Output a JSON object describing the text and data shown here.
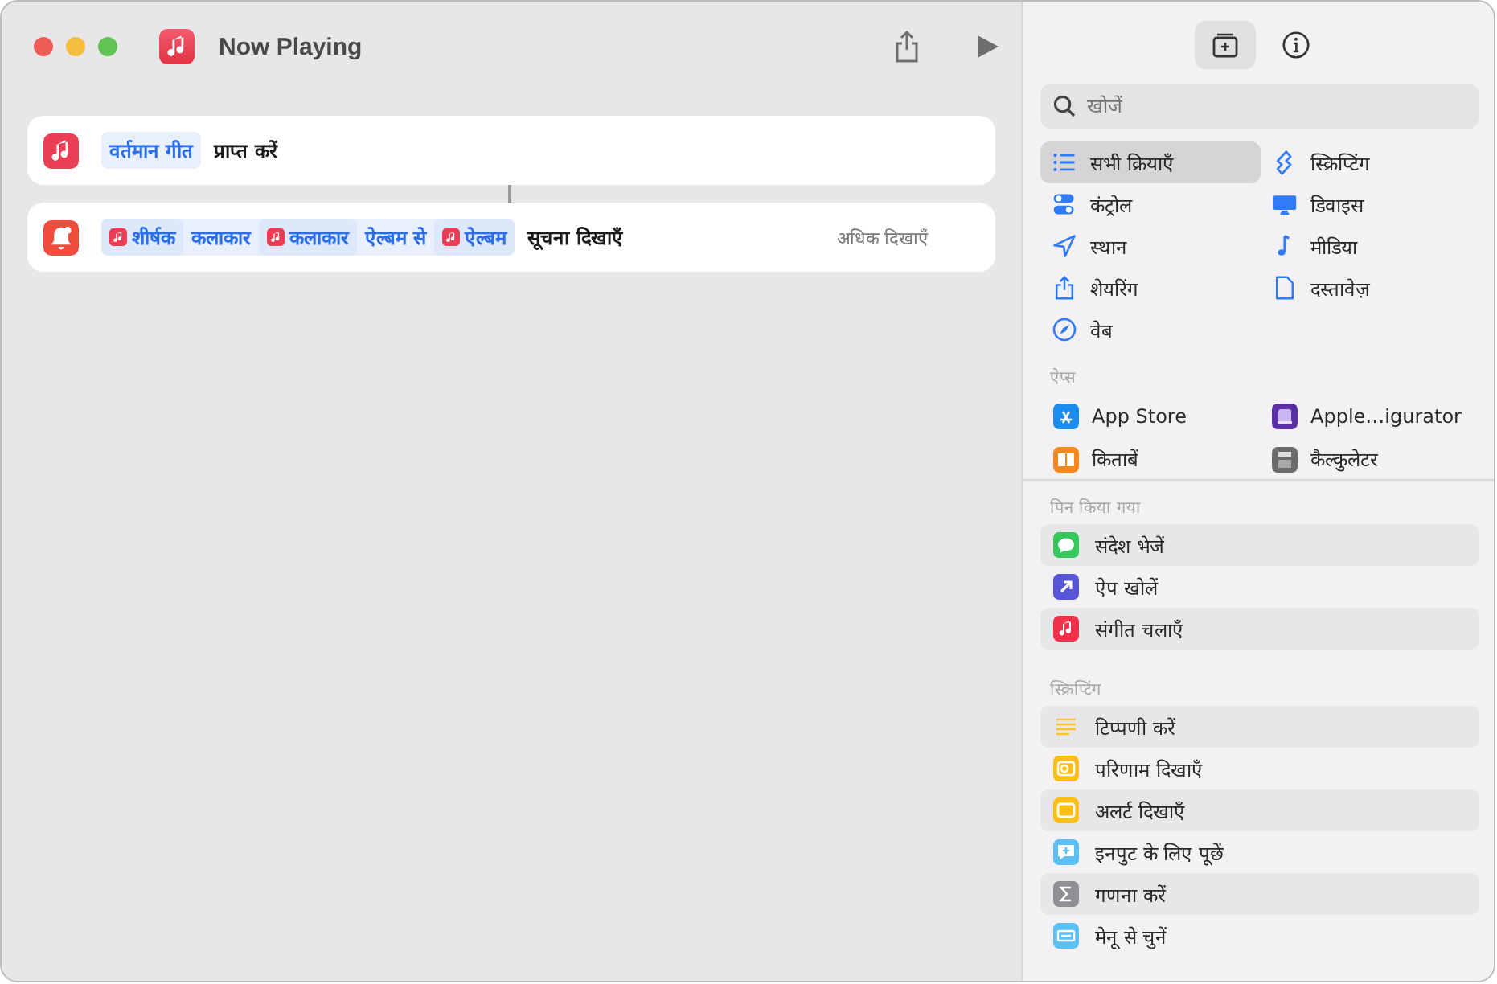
{
  "window": {
    "title": "Now Playing"
  },
  "actions": [
    {
      "kind": "get",
      "tokens": [
        {
          "text": "वर्तमान गीत",
          "icon": false
        }
      ],
      "label": "प्राप्त करें"
    },
    {
      "kind": "notify",
      "tokens": [
        {
          "text": "शीर्षक",
          "icon": true
        },
        {
          "text": "कलाकार",
          "icon": false
        },
        {
          "text": "कलाकार",
          "icon": true
        },
        {
          "text": "ऐल्बम से",
          "icon": false
        },
        {
          "text": "ऐल्बम",
          "icon": true
        }
      ],
      "label": "सूचना दिखाएँ",
      "more": "अधिक दिखाएँ"
    }
  ],
  "sidebar": {
    "tabs": [
      {
        "kind": "library",
        "selected": true
      },
      {
        "kind": "info",
        "selected": false
      }
    ],
    "search": {
      "placeholder": "खोजें"
    },
    "categories": [
      {
        "kind": "list",
        "label": "सभी क्रियाएँ",
        "selected": true
      },
      {
        "kind": "scripting",
        "label": "स्क्रिप्टिंग",
        "selected": false
      },
      {
        "kind": "toggle",
        "label": "कंट्रोल",
        "selected": false
      },
      {
        "kind": "monitor",
        "label": "डिवाइस",
        "selected": false
      },
      {
        "kind": "location",
        "label": "स्थान",
        "selected": false
      },
      {
        "kind": "note",
        "label": "मीडिया",
        "selected": false
      },
      {
        "kind": "share",
        "label": "शेयरिंग",
        "selected": false
      },
      {
        "kind": "document",
        "label": "दस्तावेज़",
        "selected": false
      },
      {
        "kind": "compass",
        "label": "वेब",
        "selected": false
      }
    ],
    "apps": {
      "heading": "ऐप्स",
      "items": [
        {
          "kind": "appstore",
          "label": "App Store",
          "color": "#1b8cf0"
        },
        {
          "kind": "configurator",
          "label": "Apple…igurator",
          "color": "#5b2fa8"
        },
        {
          "kind": "books",
          "label": "किताबें",
          "color": "#f5891f"
        },
        {
          "kind": "calculator",
          "label": "कैल्कुलेटर",
          "color": "#6b6b6b"
        }
      ]
    },
    "sections": [
      {
        "heading": "पिन किया गया",
        "items": [
          {
            "kind": "bubble",
            "label": "संदेश भेजें",
            "color": "#34c759"
          },
          {
            "kind": "arrow",
            "label": "ऐप खोलें",
            "color": "#5856d6"
          },
          {
            "kind": "music",
            "label": "संगीत चलाएँ",
            "color": "#f0334b"
          }
        ]
      },
      {
        "heading": "स्क्रिप्टिंग",
        "items": [
          {
            "kind": "lines",
            "label": "टिप्पणी करें",
            "color": "#f8c525"
          },
          {
            "kind": "result",
            "label": "परिणाम दिखाएँ",
            "color": "#fbbf16"
          },
          {
            "kind": "alert",
            "label": "अलर्ट दिखाएँ",
            "color": "#fbbf16"
          },
          {
            "kind": "ask",
            "label": "इनपुट के लिए पूछें",
            "color": "#5ac0f5"
          },
          {
            "kind": "sigma",
            "label": "गणना करें",
            "color": "#8e8e93"
          },
          {
            "kind": "menu",
            "label": "मेनू से चुनें",
            "color": "#5ac0f5"
          }
        ]
      }
    ]
  }
}
